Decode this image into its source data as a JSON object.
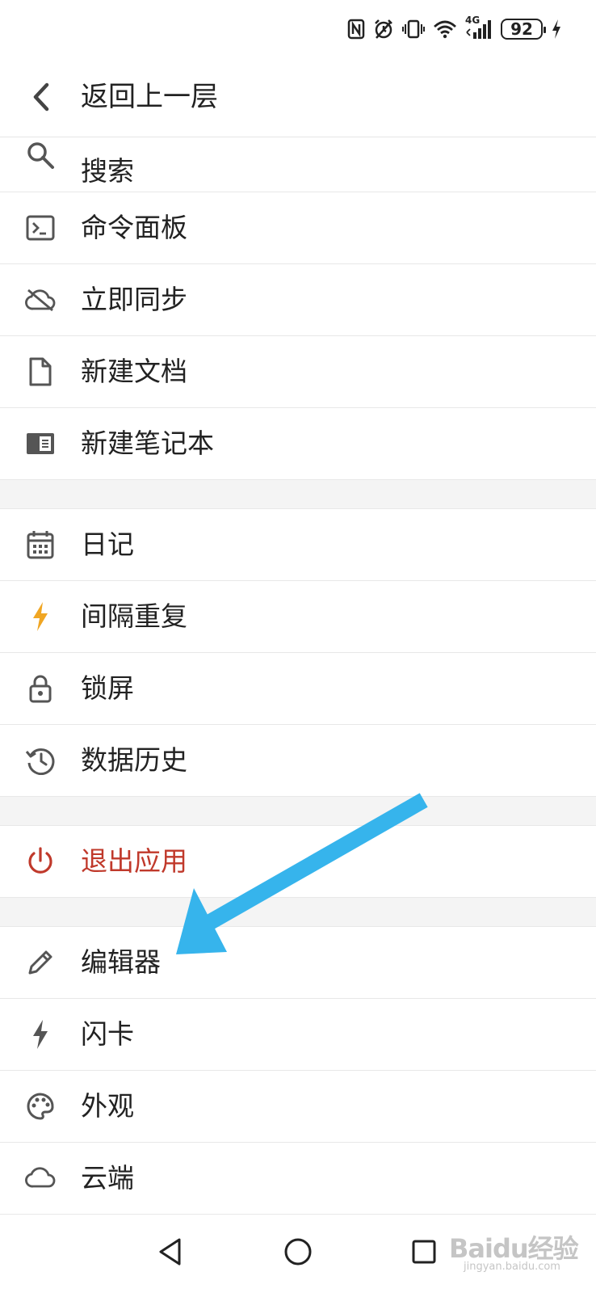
{
  "status_bar": {
    "battery_level": "92",
    "network_label": "4G",
    "icons": [
      "nfc-icon",
      "alarm-icon",
      "vibrate-icon",
      "wifi-icon",
      "signal-icon",
      "battery-icon",
      "charging-icon"
    ]
  },
  "header": {
    "back_icon": "chevron-left-icon",
    "title": "返回上一层"
  },
  "menu": {
    "group1": [
      {
        "label": "搜索",
        "icon": "search-icon"
      },
      {
        "label": "命令面板",
        "icon": "terminal-icon"
      },
      {
        "label": "立即同步",
        "icon": "cloud-off-icon"
      },
      {
        "label": "新建文档",
        "icon": "file-icon"
      },
      {
        "label": "新建笔记本",
        "icon": "notebook-icon"
      }
    ],
    "group2": [
      {
        "label": "日记",
        "icon": "calendar-icon"
      },
      {
        "label": "间隔重复",
        "icon": "lightning-icon",
        "icon_color": "#f0a623"
      },
      {
        "label": "锁屏",
        "icon": "lock-icon"
      },
      {
        "label": "数据历史",
        "icon": "history-icon"
      }
    ],
    "group3": [
      {
        "label": "退出应用",
        "icon": "power-icon",
        "color": "#c0392b"
      }
    ],
    "group4": [
      {
        "label": "编辑器",
        "icon": "pencil-icon"
      },
      {
        "label": "闪卡",
        "icon": "lightning-icon"
      },
      {
        "label": "外观",
        "icon": "palette-icon"
      },
      {
        "label": "云端",
        "icon": "cloud-icon"
      }
    ]
  },
  "annotation": {
    "arrow_color": "#36b4ec",
    "points_to": "编辑器"
  },
  "nav_bar": {
    "icons": [
      "back-triangle-icon",
      "home-circle-icon",
      "recents-square-icon"
    ]
  },
  "watermark": {
    "text": "Baidu经验",
    "subtext": "jingyan.baidu.com"
  }
}
